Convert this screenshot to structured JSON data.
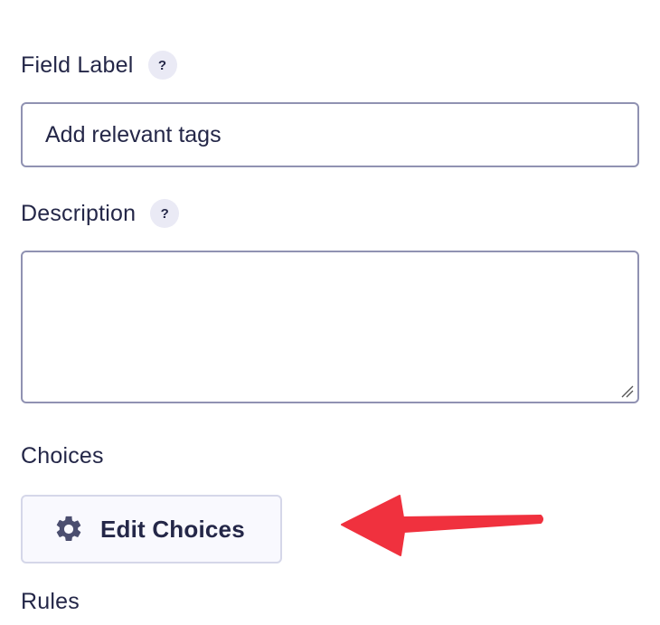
{
  "form": {
    "field_label": {
      "label": "Field Label",
      "help": "?",
      "value": "Add relevant tags"
    },
    "description": {
      "label": "Description",
      "help": "?",
      "value": ""
    },
    "choices": {
      "label": "Choices",
      "button_label": "Edit Choices",
      "button_icon": "gear-icon"
    },
    "rules": {
      "label": "Rules"
    }
  },
  "annotation": {
    "arrow_color": "#f0313e",
    "arrow_icon": "arrow-left-icon"
  },
  "colors": {
    "text": "#242748",
    "border": "#9092b2",
    "help_bg": "#eaeaf5",
    "button_bg": "#f9f9fe",
    "button_border": "#d5d7e9"
  }
}
